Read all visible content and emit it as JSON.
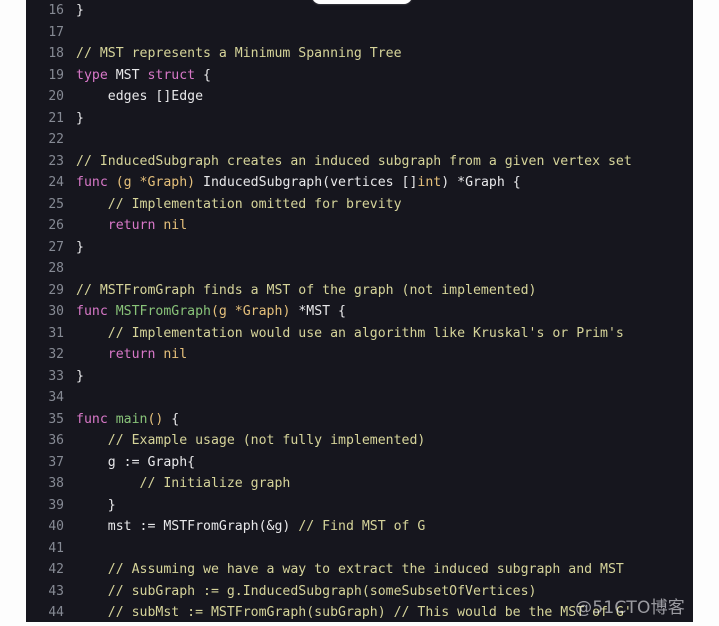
{
  "editor": {
    "language": "go",
    "theme_colors": {
      "background": "#16161e",
      "page": "#fdfdfd",
      "line_number": "#868a94",
      "text": "#e8e8ea",
      "comment": "#d6d49a",
      "keyword": "#d878c8",
      "function": "#88c379",
      "parameter": "#e5c07b",
      "literal": "#e5c07b"
    },
    "first_line_number": 16,
    "last_line_number": 44,
    "lines": [
      {
        "no": "16",
        "tokens": [
          {
            "t": "}",
            "c": "tk-txt"
          }
        ]
      },
      {
        "no": "17",
        "tokens": []
      },
      {
        "no": "18",
        "tokens": [
          {
            "t": "// MST represents a Minimum Spanning Tree",
            "c": "tk-com"
          }
        ]
      },
      {
        "no": "19",
        "tokens": [
          {
            "t": "type ",
            "c": "tk-kw"
          },
          {
            "t": "MST ",
            "c": "tk-txt"
          },
          {
            "t": "struct",
            "c": "tk-kw"
          },
          {
            "t": " {",
            "c": "tk-txt"
          }
        ]
      },
      {
        "no": "20",
        "tokens": [
          {
            "t": "    edges []Edge",
            "c": "tk-txt"
          }
        ]
      },
      {
        "no": "21",
        "tokens": [
          {
            "t": "}",
            "c": "tk-txt"
          }
        ]
      },
      {
        "no": "22",
        "tokens": []
      },
      {
        "no": "23",
        "tokens": [
          {
            "t": "// InducedSubgraph creates an induced subgraph from a given vertex set",
            "c": "tk-com"
          }
        ]
      },
      {
        "no": "24",
        "tokens": [
          {
            "t": "func ",
            "c": "tk-kw"
          },
          {
            "t": "(g *Graph)",
            "c": "tk-par"
          },
          {
            "t": " InducedSubgraph(vertices []",
            "c": "tk-txt"
          },
          {
            "t": "int",
            "c": "tk-typ"
          },
          {
            "t": ") *Graph {",
            "c": "tk-txt"
          }
        ]
      },
      {
        "no": "25",
        "tokens": [
          {
            "t": "    // Implementation omitted for brevity",
            "c": "tk-com"
          }
        ]
      },
      {
        "no": "26",
        "tokens": [
          {
            "t": "    ",
            "c": "tk-txt"
          },
          {
            "t": "return ",
            "c": "tk-kw"
          },
          {
            "t": "nil",
            "c": "tk-lit"
          }
        ]
      },
      {
        "no": "27",
        "tokens": [
          {
            "t": "}",
            "c": "tk-txt"
          }
        ]
      },
      {
        "no": "28",
        "tokens": []
      },
      {
        "no": "29",
        "tokens": [
          {
            "t": "// MSTFromGraph finds a MST of the graph (not implemented)",
            "c": "tk-com"
          }
        ]
      },
      {
        "no": "30",
        "tokens": [
          {
            "t": "func ",
            "c": "tk-kw"
          },
          {
            "t": "MSTFromGraph",
            "c": "tk-fn"
          },
          {
            "t": "(g *Graph)",
            "c": "tk-par"
          },
          {
            "t": " *MST {",
            "c": "tk-txt"
          }
        ]
      },
      {
        "no": "31",
        "tokens": [
          {
            "t": "    // Implementation would use an algorithm like Kruskal's or Prim's",
            "c": "tk-com"
          }
        ]
      },
      {
        "no": "32",
        "tokens": [
          {
            "t": "    ",
            "c": "tk-txt"
          },
          {
            "t": "return ",
            "c": "tk-kw"
          },
          {
            "t": "nil",
            "c": "tk-lit"
          }
        ]
      },
      {
        "no": "33",
        "tokens": [
          {
            "t": "}",
            "c": "tk-txt"
          }
        ]
      },
      {
        "no": "34",
        "tokens": []
      },
      {
        "no": "35",
        "tokens": [
          {
            "t": "func ",
            "c": "tk-kw"
          },
          {
            "t": "main",
            "c": "tk-fn"
          },
          {
            "t": "()",
            "c": "tk-par"
          },
          {
            "t": " {",
            "c": "tk-txt"
          }
        ]
      },
      {
        "no": "36",
        "tokens": [
          {
            "t": "    // Example usage (not fully implemented)",
            "c": "tk-com"
          }
        ]
      },
      {
        "no": "37",
        "tokens": [
          {
            "t": "    g := Graph{",
            "c": "tk-txt"
          }
        ]
      },
      {
        "no": "38",
        "tokens": [
          {
            "t": "        // Initialize graph",
            "c": "tk-com"
          }
        ]
      },
      {
        "no": "39",
        "tokens": [
          {
            "t": "    }",
            "c": "tk-txt"
          }
        ]
      },
      {
        "no": "40",
        "tokens": [
          {
            "t": "    mst := MSTFromGraph(&g) ",
            "c": "tk-txt"
          },
          {
            "t": "// Find MST of G",
            "c": "tk-com"
          }
        ]
      },
      {
        "no": "41",
        "tokens": []
      },
      {
        "no": "42",
        "tokens": [
          {
            "t": "    // Assuming we have a way to extract the induced subgraph and MST",
            "c": "tk-com"
          }
        ]
      },
      {
        "no": "43",
        "tokens": [
          {
            "t": "    // subGraph := g.InducedSubgraph(someSubsetOfVertices)",
            "c": "tk-com"
          }
        ]
      },
      {
        "no": "44",
        "tokens": [
          {
            "t": "    // subMst := MSTFromGraph(subGraph) // This would be the MST of G'",
            "c": "tk-com"
          }
        ]
      }
    ]
  },
  "watermark": {
    "text": "@51CTO博客"
  }
}
